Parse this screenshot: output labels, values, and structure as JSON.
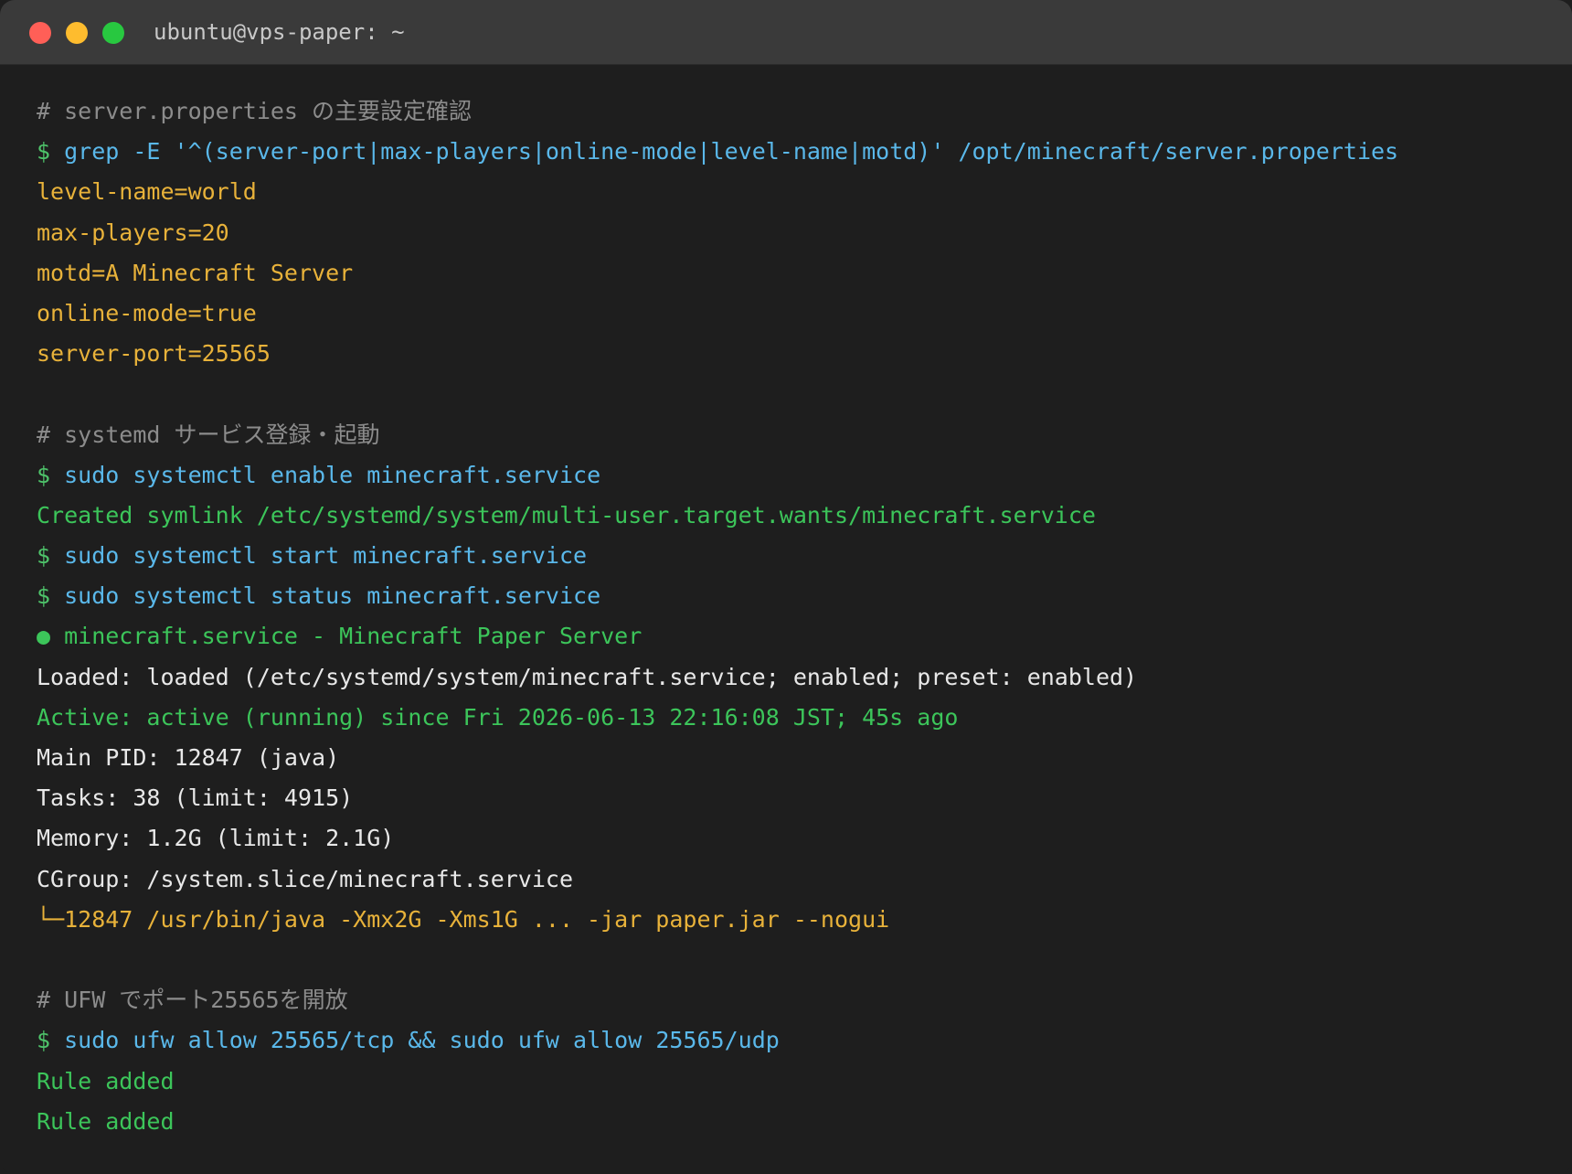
{
  "window": {
    "title": "ubuntu@vps-paper: ~"
  },
  "terminal": {
    "block1": {
      "comment": "# server.properties の主要設定確認",
      "prompt": "$",
      "command": "grep -E '^(server-port|max-players|online-mode|level-name|motd)' /opt/minecraft/server.properties",
      "output": [
        "level-name=world",
        "max-players=20",
        "motd=A Minecraft Server",
        "online-mode=true",
        "server-port=25565"
      ]
    },
    "block2": {
      "comment": "# systemd サービス登録・起動",
      "prompt1": "$",
      "command1": "sudo systemctl enable minecraft.service",
      "output1": "Created symlink /etc/systemd/system/multi-user.target.wants/minecraft.service",
      "prompt2": "$",
      "command2": "sudo systemctl start minecraft.service",
      "prompt3": "$",
      "command3": "sudo systemctl status minecraft.service",
      "status_title": "● minecraft.service - Minecraft Paper Server",
      "loaded": "Loaded: loaded (/etc/systemd/system/minecraft.service; enabled; preset: enabled)",
      "active": "Active: active (running) since Fri 2026-06-13 22:16:08 JST; 45s ago",
      "main_pid": "Main PID: 12847 (java)",
      "tasks": "Tasks: 38 (limit: 4915)",
      "memory": "Memory: 1.2G (limit: 2.1G)",
      "cgroup": "CGroup: /system.slice/minecraft.service",
      "process": "└─12847 /usr/bin/java -Xmx2G -Xms1G ... -jar paper.jar --nogui"
    },
    "block3": {
      "comment": "# UFW でポート25565を開放",
      "prompt": "$",
      "command": "sudo ufw allow 25565/tcp && sudo ufw allow 25565/udp",
      "output": [
        "Rule added",
        "Rule added"
      ]
    }
  },
  "colors": {
    "background": "#1e1e1e",
    "titlebar": "#3a3a3a",
    "comment": "#8c8c8c",
    "prompt": "#4ec36a",
    "command": "#5ab8ea",
    "yellow_output": "#e8b23a",
    "green_output": "#3cc55a",
    "white_output": "#e8e8e8"
  }
}
